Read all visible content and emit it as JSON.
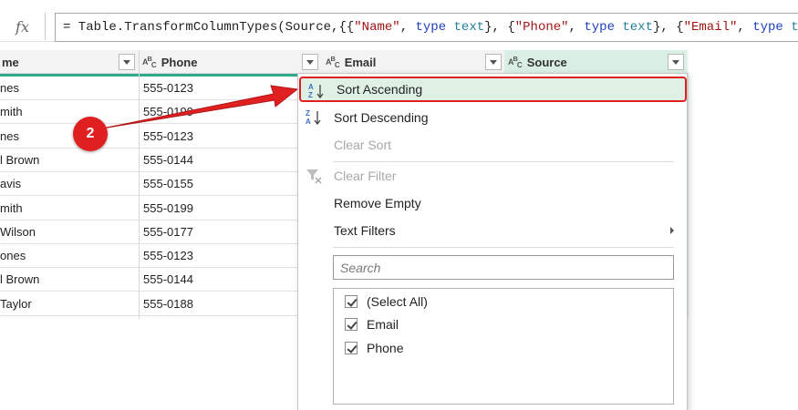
{
  "formula_bar": {
    "fx_label": "fx",
    "segments": [
      {
        "text": "= Table.TransformColumnTypes(Source,{{",
        "kind": "plain"
      },
      {
        "text": "\"Name\"",
        "kind": "str"
      },
      {
        "text": ", ",
        "kind": "plain"
      },
      {
        "text": "type",
        "kind": "kw"
      },
      {
        "text": " ",
        "kind": "plain"
      },
      {
        "text": "text",
        "kind": "type"
      },
      {
        "text": "}, {",
        "kind": "plain"
      },
      {
        "text": "\"Phone\"",
        "kind": "str"
      },
      {
        "text": ", ",
        "kind": "plain"
      },
      {
        "text": "type",
        "kind": "kw"
      },
      {
        "text": " ",
        "kind": "plain"
      },
      {
        "text": "text",
        "kind": "type"
      },
      {
        "text": "}, {",
        "kind": "plain"
      },
      {
        "text": "\"Email\"",
        "kind": "str"
      },
      {
        "text": ", ",
        "kind": "plain"
      },
      {
        "text": "type",
        "kind": "kw"
      },
      {
        "text": " ",
        "kind": "plain"
      },
      {
        "text": "tex",
        "kind": "type"
      }
    ]
  },
  "columns": {
    "name_partial": "me",
    "type_icon": "ABC",
    "phone": "Phone",
    "email": "Email",
    "source": "Source"
  },
  "rows": [
    {
      "name": "nes",
      "phone": "555-0123"
    },
    {
      "name": "mith",
      "phone": "555-0199"
    },
    {
      "name": "nes",
      "phone": "555-0123"
    },
    {
      "name": "l Brown",
      "phone": "555-0144"
    },
    {
      "name": "avis",
      "phone": "555-0155"
    },
    {
      "name": "mith",
      "phone": "555-0199"
    },
    {
      "name": "Wilson",
      "phone": "555-0177"
    },
    {
      "name": "ones",
      "phone": "555-0123"
    },
    {
      "name": "l Brown",
      "phone": "555-0144"
    },
    {
      "name": "Taylor",
      "phone": "555-0188"
    }
  ],
  "menu": {
    "sort_ascending": "Sort Ascending",
    "sort_descending": "Sort Descending",
    "clear_sort": "Clear Sort",
    "clear_filter": "Clear Filter",
    "remove_empty": "Remove Empty",
    "text_filters": "Text Filters",
    "search_placeholder": "Search",
    "checklist": [
      "(Select All)",
      "Email",
      "Phone"
    ]
  },
  "annotation": {
    "badge": "2"
  },
  "colors": {
    "accent_teal": "#2eaa8c",
    "highlight_green": "#dff0e5",
    "annotation_red": "#e02020"
  }
}
